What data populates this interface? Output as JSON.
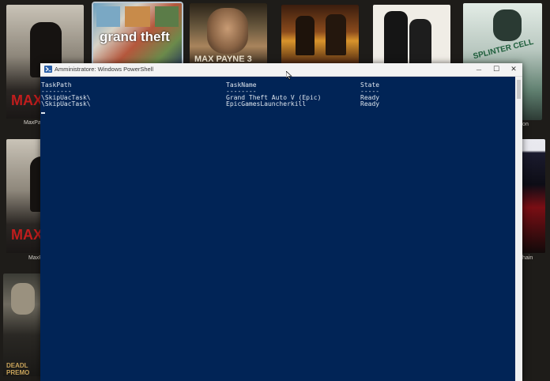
{
  "library": {
    "tiles": [
      {
        "label": "MaxPayn",
        "cover_text": "MAX"
      },
      {
        "label": "",
        "cover_text": "grand theft"
      },
      {
        "label": "",
        "cover_text": "MAX PAYNE 3"
      },
      {
        "label": "",
        "cover_text": ""
      },
      {
        "label": "",
        "cover_text": ""
      },
      {
        "label": "ition",
        "cover_text": "SPLINTER CELL"
      },
      {
        "label": "MaxP",
        "cover_text": "MAX"
      },
      {
        "label": "hain",
        "cover_text": ""
      },
      {
        "label": "",
        "cover_text": "DEADL PREMO"
      }
    ]
  },
  "window": {
    "title": "Amministratore: Windows PowerShell",
    "minimize_glyph": "—",
    "maximize_glyph": "☐",
    "close_glyph": "✕"
  },
  "console": {
    "headers": {
      "taskpath": "TaskPath",
      "taskname": "TaskName",
      "state": "State"
    },
    "separators": {
      "taskpath": "--------",
      "taskname": "--------",
      "state": "-----"
    },
    "rows": [
      {
        "taskpath": "\\SkipUacTask\\",
        "taskname": "Grand Theft Auto V (Epic)",
        "state": "Ready"
      },
      {
        "taskpath": "\\SkipUacTask\\",
        "taskname": "EpicGamesLauncherkill",
        "state": "Ready"
      }
    ]
  },
  "colors": {
    "console_bg": "#012456",
    "console_fg": "#dfe6ee",
    "titlebar_bg": "#f3f3f3"
  }
}
